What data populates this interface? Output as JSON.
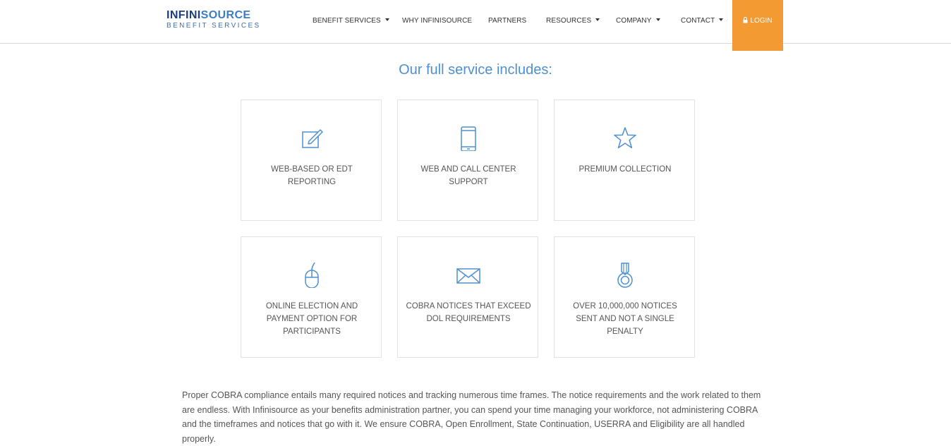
{
  "header": {
    "logo_main_a": "INFINI",
    "logo_main_b": "SOURCE",
    "logo_sub": "BENEFIT SERVICES",
    "nav": [
      {
        "label": "BENEFIT SERVICES",
        "dropdown": true
      },
      {
        "label": "WHY INFINISOURCE",
        "dropdown": false
      },
      {
        "label": "PARTNERS",
        "dropdown": false
      },
      {
        "label": "RESOURCES",
        "dropdown": true
      },
      {
        "label": "COMPANY",
        "dropdown": true
      },
      {
        "label": "CONTACT",
        "dropdown": true
      }
    ],
    "login_label": "LOGIN",
    "login_color": "#f39a33"
  },
  "main": {
    "heading": "Our full service includes:",
    "features": [
      {
        "icon": "edit-icon",
        "label": "WEB-BASED OR EDT REPORTING"
      },
      {
        "icon": "mobile-phone-icon",
        "label": "WEB AND CALL CENTER SUPPORT"
      },
      {
        "icon": "star-icon",
        "label": "PREMIUM COLLECTION"
      },
      {
        "icon": "mouse-icon",
        "label": "ONLINE ELECTION AND PAYMENT OPTION FOR PARTICIPANTS"
      },
      {
        "icon": "envelope-icon",
        "label": "COBRA NOTICES THAT EXCEED DOL REQUIREMENTS"
      },
      {
        "icon": "medal-icon",
        "label": "OVER 10,000,000 NOTICES SENT AND NOT A SINGLE PENALTY"
      }
    ],
    "paragraph": "Proper COBRA compliance entails many required notices and tracking numerous time frames. The notice requirements and the work related to them are endless. With Infinisource as your benefits administration partner, you can spend your time managing your workforce, not administering COBRA and the timeframes and notices that go with it. We ensure COBRA, Open Enrollment, State Continuation, USERRA and Eligibility are all handled properly."
  },
  "colors": {
    "accent_blue": "#4e8fd0",
    "brand_navy": "#1d3e7a"
  }
}
